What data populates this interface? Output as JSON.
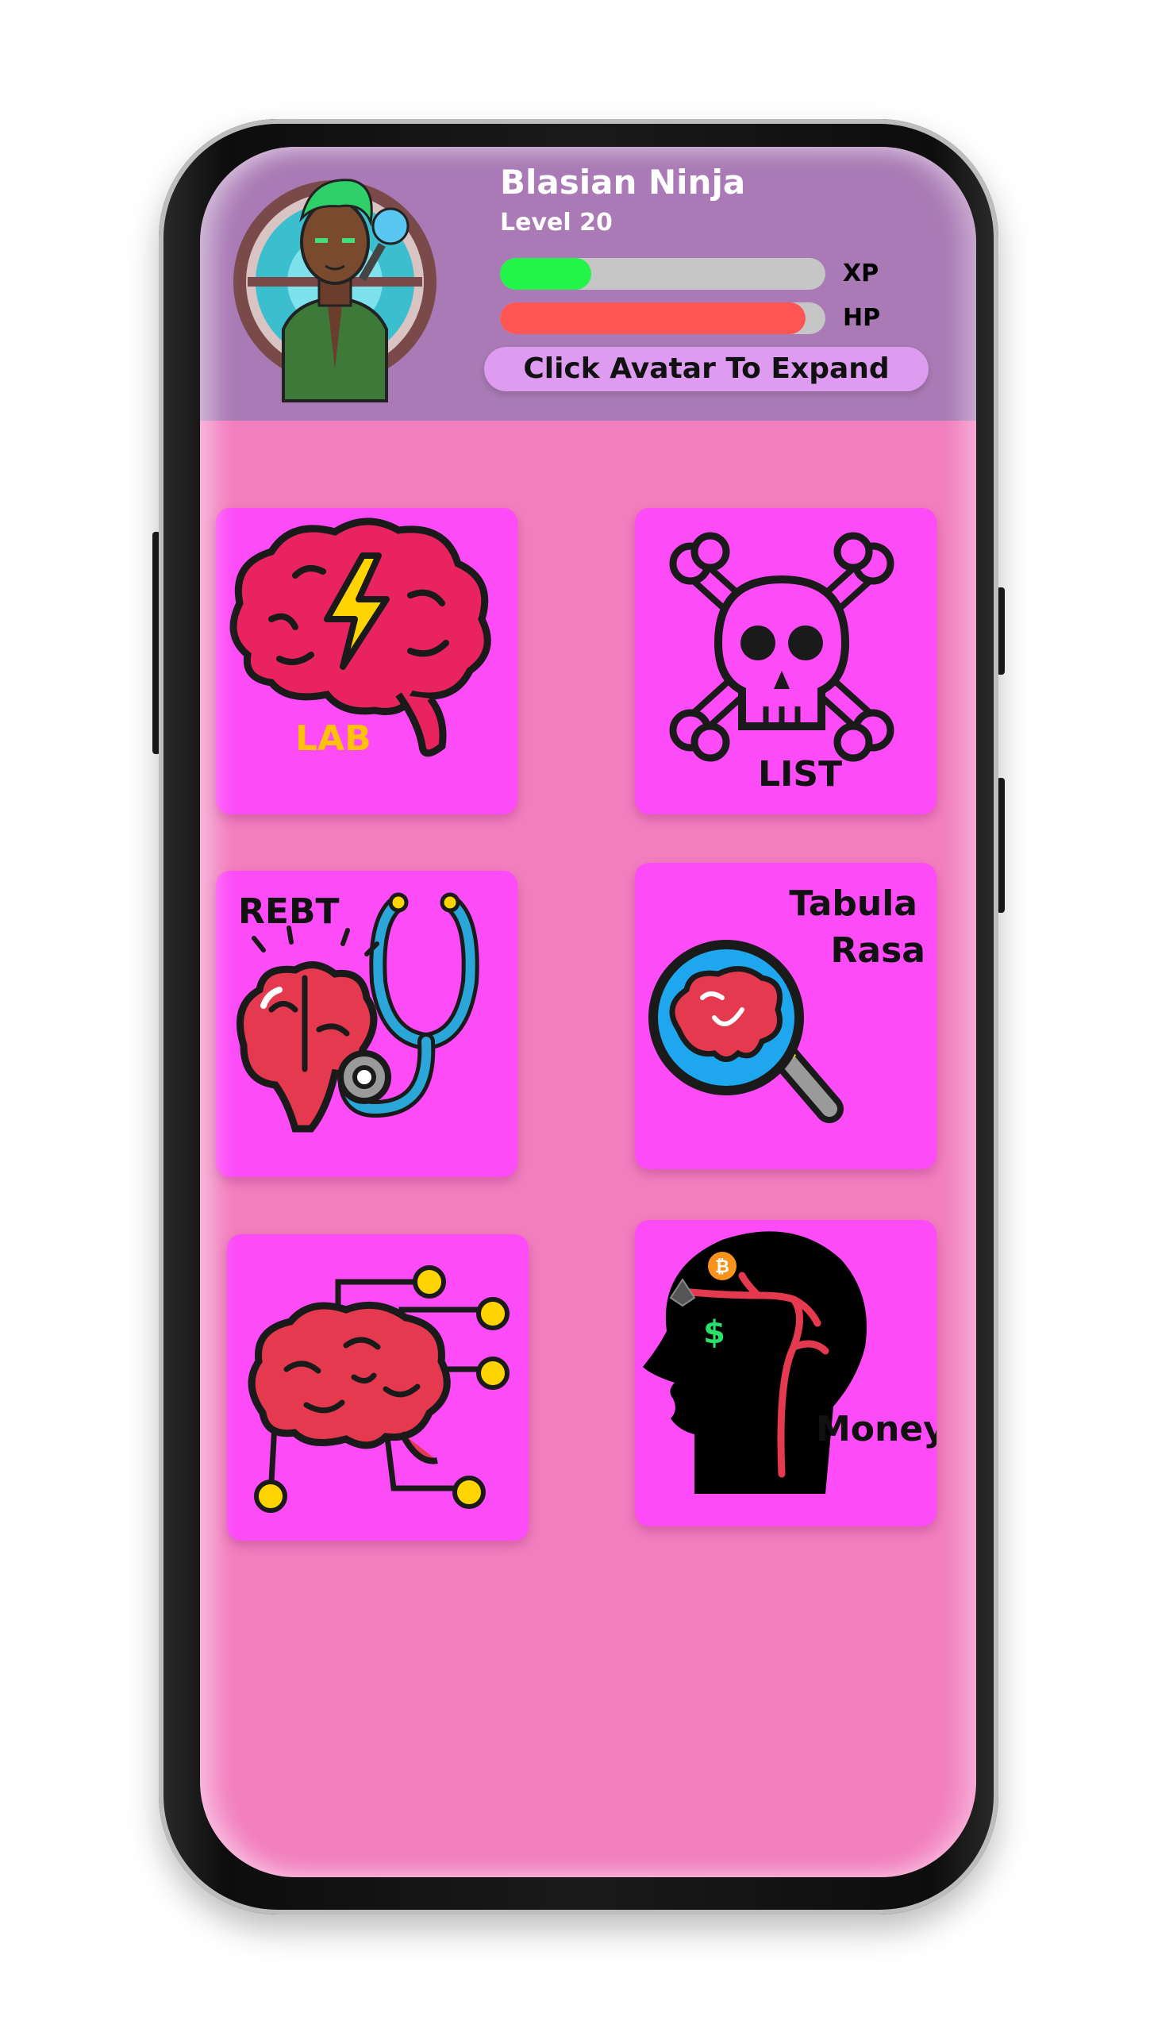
{
  "profile": {
    "name": "Blasian Ninja",
    "level": "Level 20",
    "xp_label": "XP",
    "hp_label": "HP",
    "xp_progress": 0.28,
    "hp_progress": 0.94,
    "expand_label": "Click Avatar To Expand"
  },
  "tiles": [
    {
      "id": "lab",
      "label": "LAB",
      "icon": "brain-lightning-icon"
    },
    {
      "id": "list",
      "label": "LIST",
      "icon": "skull-crossbones-icon"
    },
    {
      "id": "rebt",
      "label": "REBT",
      "icon": "brain-stethoscope-icon"
    },
    {
      "id": "tabula-rasa",
      "label_line1": "Tabula",
      "label_line2": "Rasa",
      "icon": "brain-magnifier-icon"
    },
    {
      "id": "neural",
      "label": "",
      "icon": "brain-circuit-icon"
    },
    {
      "id": "money",
      "label": "Money",
      "icon": "head-crypto-icon"
    }
  ],
  "colors": {
    "header_bg": "#a97ab5",
    "screen_bg": "#f27ebf",
    "tile_bg": "#fd4bf7",
    "xp_fill": "#22f44a",
    "hp_fill": "#ff5555",
    "lab_label": "#ffc107"
  }
}
